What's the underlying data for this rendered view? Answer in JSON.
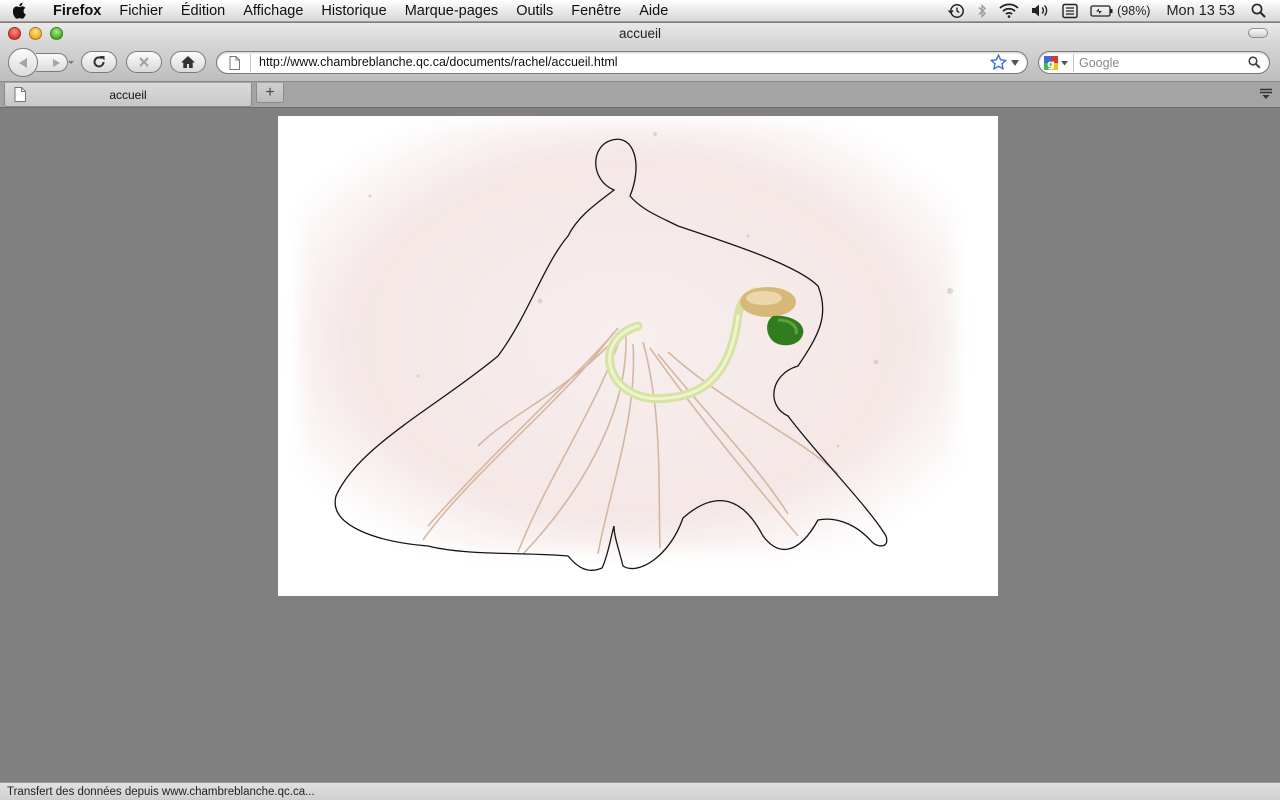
{
  "menubar": {
    "app_name": "Firefox",
    "items": [
      "Fichier",
      "Édition",
      "Affichage",
      "Historique",
      "Marque-pages",
      "Outils",
      "Fenêtre",
      "Aide"
    ],
    "battery": "(98%)",
    "clock": "Mon 13 53"
  },
  "window": {
    "title": "accueil"
  },
  "toolbar": {
    "url": "http://www.chambreblanche.qc.ca/documents/rachel/accueil.html",
    "search_placeholder": "Google"
  },
  "tabs": [
    {
      "label": "accueil",
      "active": true
    }
  ],
  "newtab_label": "+",
  "status": {
    "text": "Transfert des données depuis www.chambreblanche.qc.ca..."
  },
  "icons": {
    "menubar_right": [
      "time-machine-icon",
      "bluetooth-icon",
      "wifi-icon",
      "volume-icon",
      "keyboard-icon",
      "battery-icon",
      "spotlight-icon"
    ],
    "toolbar": [
      "back-icon",
      "forward-icon",
      "reload-icon",
      "stop-icon",
      "home-icon",
      "star-icon",
      "google-icon",
      "magnifier-icon"
    ]
  },
  "colors": {
    "content_bg": "#808080",
    "artwork_bg": "#ffffff"
  }
}
